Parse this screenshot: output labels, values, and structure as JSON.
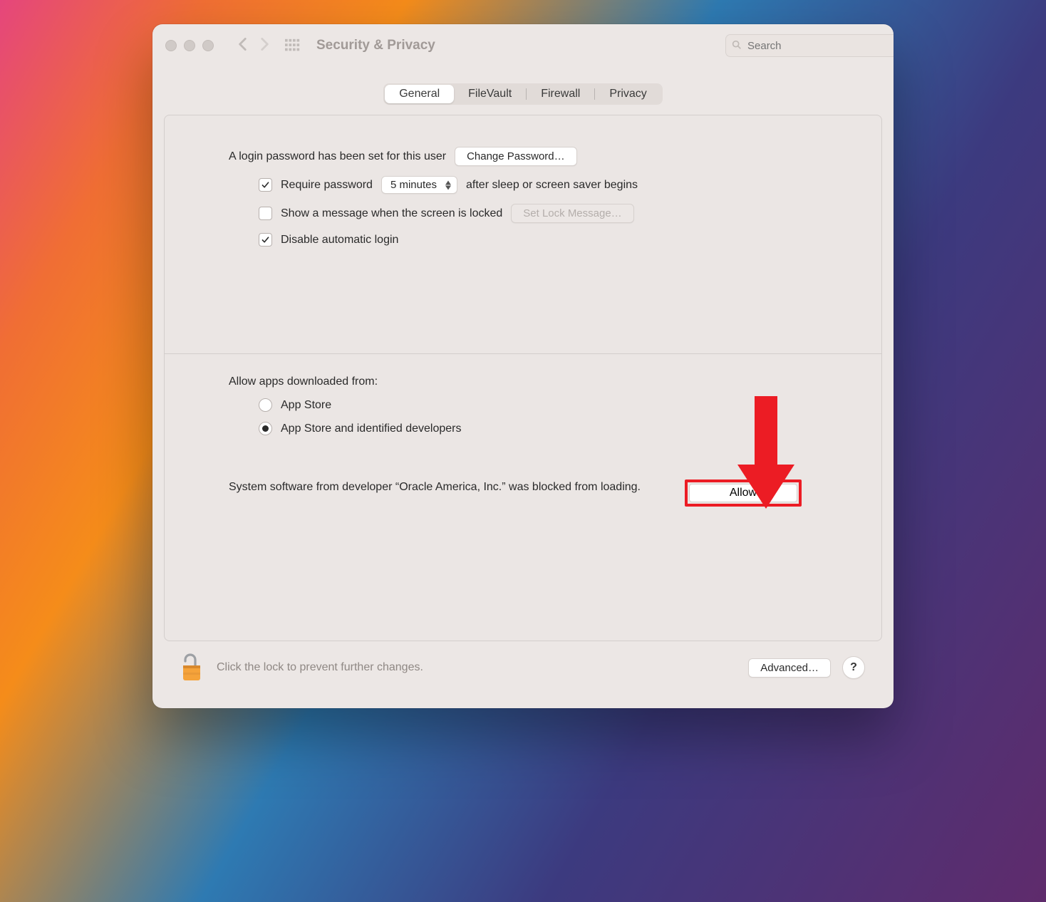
{
  "window": {
    "title": "Security & Privacy"
  },
  "search": {
    "placeholder": "Search"
  },
  "tabs": {
    "general": "General",
    "filevault": "FileVault",
    "firewall": "Firewall",
    "privacy": "Privacy",
    "active": "general"
  },
  "login": {
    "password_set_text": "A login password has been set for this user",
    "change_password_btn": "Change Password…",
    "require_password_label": "Require password",
    "require_password_delay": "5 minutes",
    "require_password_suffix": "after sleep or screen saver begins",
    "show_message_label": "Show a message when the screen is locked",
    "set_lock_message_btn": "Set Lock Message…",
    "disable_auto_login_label": "Disable automatic login"
  },
  "allow_apps": {
    "heading": "Allow apps downloaded from:",
    "option_app_store": "App Store",
    "option_identified": "App Store and identified developers",
    "selected": "identified"
  },
  "blocked": {
    "message": "System software from developer “Oracle America, Inc.” was blocked from loading.",
    "allow_btn": "Allow"
  },
  "footer": {
    "lock_text": "Click the lock to prevent further changes.",
    "advanced_btn": "Advanced…",
    "help_btn": "?"
  },
  "annotation": {
    "arrow_color": "#ec1c24"
  }
}
